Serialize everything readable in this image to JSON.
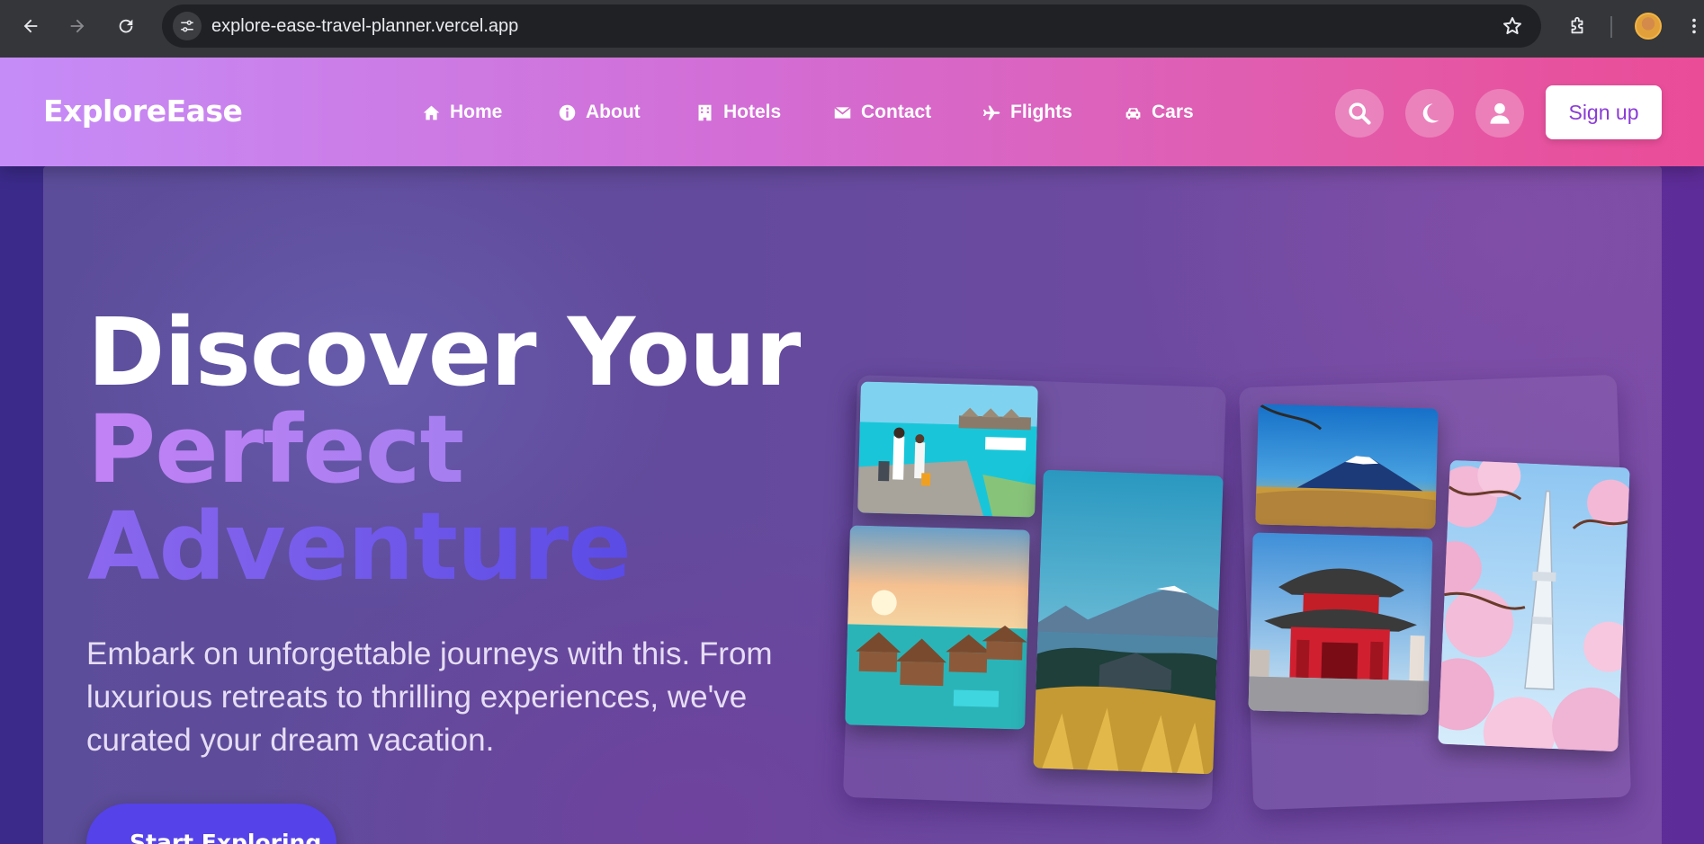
{
  "browser": {
    "url": "explore-ease-travel-planner.vercel.app",
    "back_icon": "arrow-left-icon",
    "forward_icon": "arrow-right-icon",
    "reload_icon": "reload-icon",
    "bookmark_icon": "star-icon",
    "extensions_icon": "puzzle-icon"
  },
  "navbar": {
    "brand": "ExploreEase",
    "links": [
      {
        "label": "Home",
        "icon": "home-icon"
      },
      {
        "label": "About",
        "icon": "info-icon"
      },
      {
        "label": "Hotels",
        "icon": "hotel-icon"
      },
      {
        "label": "Contact",
        "icon": "envelope-icon"
      },
      {
        "label": "Flights",
        "icon": "plane-icon"
      },
      {
        "label": "Cars",
        "icon": "car-icon"
      }
    ],
    "signup_label": "Sign up",
    "colors": {
      "gradient_start": "#c58cf8",
      "gradient_end": "#ea4c98"
    }
  },
  "hero": {
    "title_line1": "Discover Your",
    "title_line2": "Perfect",
    "title_line3": "Adventure",
    "description": "Embark on unforgettable journeys with this. From luxurious retreats to thrilling experiences, we've curated your dream vacation.",
    "cta_label": "Start Exploring",
    "colors": {
      "accent_purple": "#c282f5",
      "accent_indigo": "#5542e8"
    }
  },
  "gallery": [
    {
      "name": "maldives-pier-photo"
    },
    {
      "name": "overwater-bungalows-photo"
    },
    {
      "name": "mount-fuji-lake-photo"
    },
    {
      "name": "mount-fuji-sunrise-photo"
    },
    {
      "name": "japanese-temple-photo"
    },
    {
      "name": "cherry-blossom-tower-photo"
    }
  ]
}
